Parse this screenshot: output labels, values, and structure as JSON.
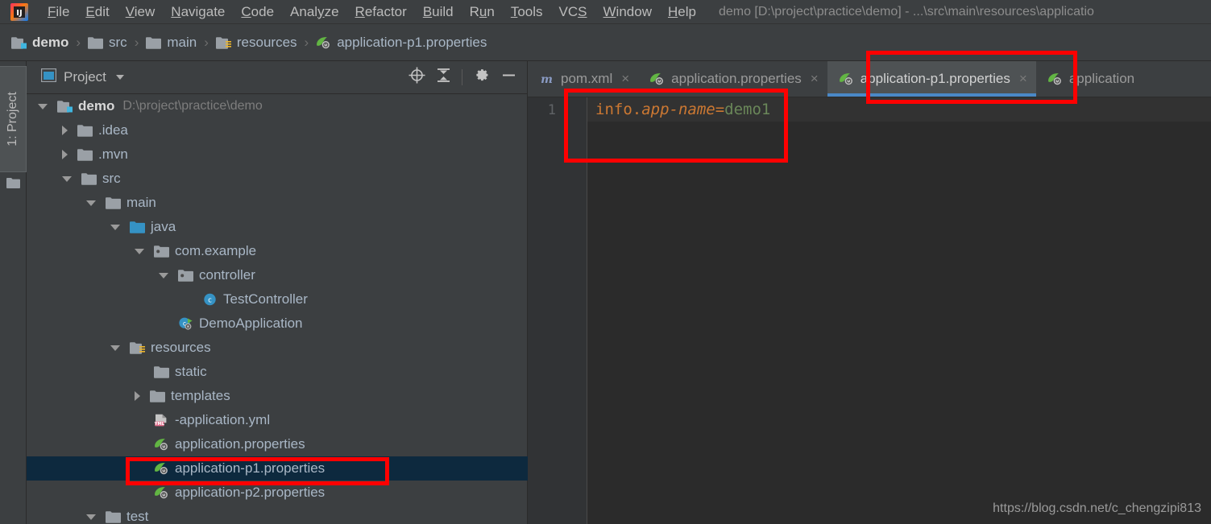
{
  "window": {
    "title": "demo [D:\\project\\practice\\demo] - ...\\src\\main\\resources\\applicatio",
    "logo_icon": "intellij-idea-logo"
  },
  "menubar": {
    "items": [
      {
        "label": "File",
        "mnemonic": "F"
      },
      {
        "label": "Edit",
        "mnemonic": "E"
      },
      {
        "label": "View",
        "mnemonic": "V"
      },
      {
        "label": "Navigate",
        "mnemonic": "N"
      },
      {
        "label": "Code",
        "mnemonic": "C"
      },
      {
        "label": "Analyze",
        "mnemonic": "y"
      },
      {
        "label": "Refactor",
        "mnemonic": "R"
      },
      {
        "label": "Build",
        "mnemonic": "B"
      },
      {
        "label": "Run",
        "mnemonic": "u"
      },
      {
        "label": "Tools",
        "mnemonic": "T"
      },
      {
        "label": "VCS",
        "mnemonic": "S"
      },
      {
        "label": "Window",
        "mnemonic": "W"
      },
      {
        "label": "Help",
        "mnemonic": "H"
      }
    ]
  },
  "breadcrumb": {
    "items": [
      {
        "label": "demo",
        "icon": "module-folder-icon"
      },
      {
        "label": "src",
        "icon": "folder-icon"
      },
      {
        "label": "main",
        "icon": "folder-icon"
      },
      {
        "label": "resources",
        "icon": "resources-folder-icon"
      },
      {
        "label": "application-p1.properties",
        "icon": "spring-properties-icon"
      }
    ],
    "separator": "›"
  },
  "toolstrip": {
    "project_tab_label": "1: Project",
    "project_tab_icon": "folder-icon"
  },
  "project_panel": {
    "title": "Project",
    "title_icon": "project-view-icon",
    "actions": [
      {
        "name": "locate-file-icon",
        "label": "Select Opened File"
      },
      {
        "name": "collapse-all-icon",
        "label": "Collapse All"
      },
      {
        "name": "gear-icon",
        "label": "Settings"
      },
      {
        "name": "minimize-icon",
        "label": "Hide"
      }
    ],
    "tree": [
      {
        "label": "demo",
        "path": "D:\\project\\practice\\demo",
        "depth": 0,
        "twist": "open",
        "icon": "module-folder-icon",
        "bold": true,
        "selected": false
      },
      {
        "label": ".idea",
        "path": "",
        "depth": 1,
        "twist": "closed",
        "icon": "folder-icon",
        "bold": false,
        "selected": false
      },
      {
        "label": ".mvn",
        "path": "",
        "depth": 1,
        "twist": "closed",
        "icon": "folder-icon",
        "bold": false,
        "selected": false
      },
      {
        "label": "src",
        "path": "",
        "depth": 1,
        "twist": "open",
        "icon": "folder-icon",
        "bold": false,
        "selected": false
      },
      {
        "label": "main",
        "path": "",
        "depth": 2,
        "twist": "open",
        "icon": "folder-icon",
        "bold": false,
        "selected": false
      },
      {
        "label": "java",
        "path": "",
        "depth": 3,
        "twist": "open",
        "icon": "source-folder-icon",
        "bold": false,
        "selected": false
      },
      {
        "label": "com.example",
        "path": "",
        "depth": 4,
        "twist": "open",
        "icon": "package-icon",
        "bold": false,
        "selected": false
      },
      {
        "label": "controller",
        "path": "",
        "depth": 5,
        "twist": "open",
        "icon": "package-icon",
        "bold": false,
        "selected": false
      },
      {
        "label": "TestController",
        "path": "",
        "depth": 6,
        "twist": "none",
        "icon": "java-class-icon",
        "bold": false,
        "selected": false
      },
      {
        "label": "DemoApplication",
        "path": "",
        "depth": 5,
        "twist": "none",
        "icon": "spring-boot-class-icon",
        "bold": false,
        "selected": false
      },
      {
        "label": "resources",
        "path": "",
        "depth": 3,
        "twist": "open",
        "icon": "resources-folder-icon",
        "bold": false,
        "selected": false
      },
      {
        "label": "static",
        "path": "",
        "depth": 4,
        "twist": "none",
        "icon": "folder-icon",
        "bold": false,
        "selected": false
      },
      {
        "label": "templates",
        "path": "",
        "depth": 4,
        "twist": "closed",
        "icon": "folder-icon",
        "bold": false,
        "selected": false
      },
      {
        "label": "-application.yml",
        "path": "",
        "depth": 4,
        "twist": "none",
        "icon": "yml-file-icon",
        "bold": false,
        "selected": false
      },
      {
        "label": "application.properties",
        "path": "",
        "depth": 4,
        "twist": "none",
        "icon": "spring-properties-icon",
        "bold": false,
        "selected": false
      },
      {
        "label": "application-p1.properties",
        "path": "",
        "depth": 4,
        "twist": "none",
        "icon": "spring-properties-icon",
        "bold": false,
        "selected": true
      },
      {
        "label": "application-p2.properties",
        "path": "",
        "depth": 4,
        "twist": "none",
        "icon": "spring-properties-icon",
        "bold": false,
        "selected": false
      },
      {
        "label": "test",
        "path": "",
        "depth": 2,
        "twist": "open",
        "icon": "folder-icon",
        "bold": false,
        "selected": false
      }
    ]
  },
  "editor": {
    "tabs": [
      {
        "label": "pom.xml",
        "icon": "maven-icon",
        "active": false,
        "close": "×"
      },
      {
        "label": "application.properties",
        "icon": "spring-properties-icon",
        "active": false,
        "close": "×"
      },
      {
        "label": "application-p1.properties",
        "icon": "spring-properties-icon",
        "active": true,
        "close": "×"
      },
      {
        "label": "application",
        "icon": "spring-properties-icon",
        "active": false,
        "close": ""
      }
    ],
    "line_number": "1",
    "code": {
      "key": "info.",
      "key_italic": "app-name",
      "equals": "=",
      "value": "demo1"
    }
  },
  "watermark": "https://blog.csdn.net/c_chengzipi813",
  "annotations": [
    {
      "name": "annotation-box-tab",
      "target": "active-editor-tab"
    },
    {
      "name": "annotation-box-code",
      "target": "editor-code-line"
    },
    {
      "name": "annotation-box-tree",
      "target": "tree-selected-row"
    }
  ],
  "colors": {
    "accent_tab_underline": "#4a88c7",
    "selection_bg": "#0d293e",
    "annotation_red": "#ff0000",
    "editor_bg": "#2b2b2b",
    "panel_bg": "#3c3f41"
  }
}
